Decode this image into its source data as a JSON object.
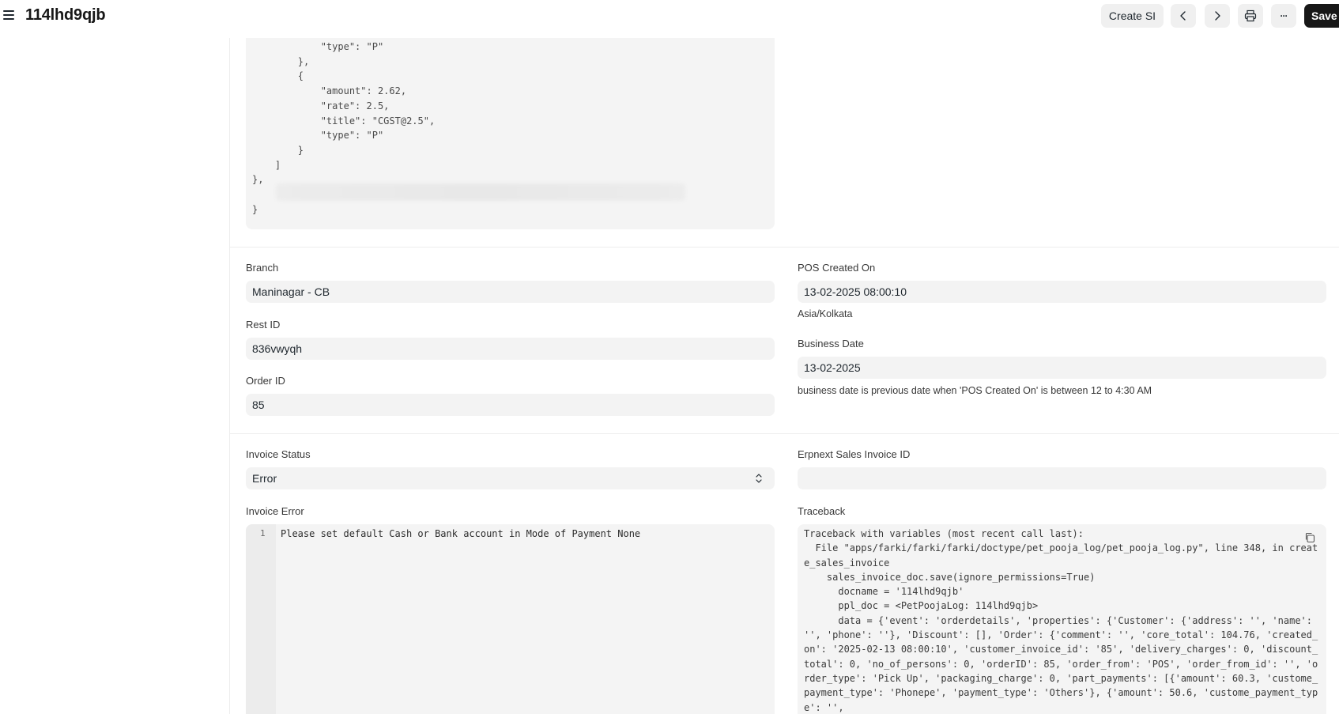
{
  "header": {
    "title": "114lhd9qjb",
    "create_si_label": "Create SI",
    "save_label": "Save",
    "more_label": "···"
  },
  "json_block": {
    "lines": [
      "            \"type\": \"P\"",
      "        },",
      "        {",
      "            \"amount\": 2.62,",
      "            \"rate\": 2.5,",
      "            \"title\": \"CGST@2.5\",",
      "            \"type\": \"P\"",
      "        }",
      "    ]",
      "},",
      "",
      "}"
    ]
  },
  "form": {
    "branch": {
      "label": "Branch",
      "value": "Maninagar - CB"
    },
    "rest_id": {
      "label": "Rest ID",
      "value": "836vwyqh"
    },
    "order_id": {
      "label": "Order ID",
      "value": "85"
    },
    "pos_created_on": {
      "label": "POS Created On",
      "value": "13-02-2025 08:00:10",
      "timezone": "Asia/Kolkata"
    },
    "business_date": {
      "label": "Business Date",
      "value": "13-02-2025",
      "help": "business date is previous date when 'POS Created On' is between 12 to 4:30 AM"
    },
    "invoice_status": {
      "label": "Invoice Status",
      "value": "Error"
    },
    "erpnext_sales_invoice_id": {
      "label": "Erpnext Sales Invoice ID",
      "value": ""
    },
    "invoice_error": {
      "label": "Invoice Error",
      "line_number": "1",
      "value": "Please set default Cash or Bank account in Mode of Payment None"
    },
    "traceback": {
      "label": "Traceback",
      "value": "Traceback with variables (most recent call last):\n  File \"apps/farki/farki/farki/doctype/pet_pooja_log/pet_pooja_log.py\", line 348, in create_sales_invoice\n    sales_invoice_doc.save(ignore_permissions=True)\n      docname = '114lhd9qjb'\n      ppl_doc = <PetPoojaLog: 114lhd9qjb>\n      data = {'event': 'orderdetails', 'properties': {'Customer': {'address': '', 'name': '', 'phone': ''}, 'Discount': [], 'Order': {'comment': '', 'core_total': 104.76, 'created_on': '2025-02-13 08:00:10', 'customer_invoice_id': '85', 'delivery_charges': 0, 'discount_total': 0, 'no_of_persons': 0, 'orderID': 85, 'order_from': 'POS', 'order_from_id': '', 'order_type': 'Pick Up', 'packaging_charge': 0, 'part_payments': [{'amount': 60.3, 'custome_payment_type': 'Phonepe', 'payment_type': 'Others'}, {'amount': 50.6, 'custome_payment_type': '',"
    }
  }
}
